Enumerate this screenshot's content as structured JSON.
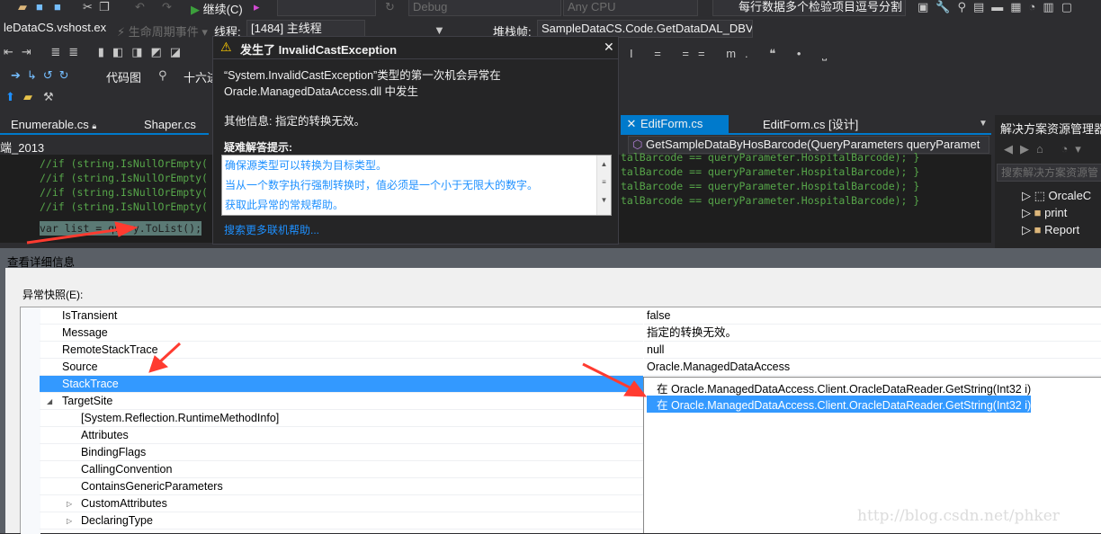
{
  "toolbar": {
    "continue_label": "继续(C)",
    "config": "Debug",
    "platform": "Any CPU",
    "search_combo": "每行数据多个检验项目逗号分割"
  },
  "debug_bar": {
    "process": "leDataCS.vshost.ex",
    "lifecycle": "生命周期事件",
    "thread_label": "线程:",
    "thread": "[1484] 主线程",
    "stackframe_label": "堆栈帧:",
    "stackframe": "SampleDataCS.Code.GetDataDAL_DBV"
  },
  "toolbar2": {
    "codemap": "代码图",
    "hex": "十六进"
  },
  "tabs": {
    "left": [
      "Enumerable.cs",
      "Shaper.cs"
    ],
    "right_active": "EditForm.cs",
    "right_other": "EditForm.cs [设计]"
  },
  "nav": {
    "left": "端_2013",
    "method": "GetSampleDataByHosBarcode(QueryParameters queryParamet"
  },
  "code": {
    "lines": [
      "//if (string.IsNullOrEmpty(",
      "//if (string.IsNullOrEmpty(",
      "//if (string.IsNullOrEmpty(",
      "//if (string.IsNullOrEmpty("
    ],
    "right_lines": [
      "talBarcode == queryParameter.HospitalBarcode); }",
      "talBarcode == queryParameter.HospitalBarcode); }",
      "talBarcode == queryParameter.HospitalBarcode); }",
      "talBarcode == queryParameter.HospitalBarcode); }"
    ],
    "current": "var list = query.ToList();"
  },
  "solution_explorer": {
    "title": "解决方案资源管理器",
    "search_placeholder": "搜索解决方案资源管",
    "items": [
      "OrcaleC",
      "print",
      "Report"
    ]
  },
  "exception": {
    "title": "发生了 InvalidCastException",
    "message_line1": "“System.InvalidCastException”类型的第一次机会异常在",
    "message_line2": "Oracle.ManagedDataAccess.dll 中发生",
    "other_info": "其他信息: 指定的转换无效。",
    "tips_label": "疑难解答提示:",
    "tips": [
      "确保源类型可以转换为目标类型。",
      "当从一个数字执行强制转换时，值必须是一个小于无限大的数字。",
      "获取此异常的常规帮助。"
    ],
    "search_link": "搜索更多联机帮助..."
  },
  "dialog": {
    "title": "查看详细信息",
    "snapshot_label": "异常快照(E):",
    "rows": [
      {
        "name": "IsTransient",
        "value": "false"
      },
      {
        "name": "Message",
        "value": "指定的转换无效。"
      },
      {
        "name": "RemoteStackTrace",
        "value": "null"
      },
      {
        "name": "Source",
        "value": "Oracle.ManagedDataAccess"
      },
      {
        "name": "StackTrace",
        "value": ""
      },
      {
        "name": "TargetSite",
        "value": ""
      },
      {
        "name": "[System.Reflection.RuntimeMethodInfo]",
        "value": ""
      },
      {
        "name": "Attributes",
        "value": ""
      },
      {
        "name": "BindingFlags",
        "value": ""
      },
      {
        "name": "CallingConvention",
        "value": ""
      },
      {
        "name": "ContainsGenericParameters",
        "value": ""
      },
      {
        "name": "CustomAttributes",
        "value": ""
      },
      {
        "name": "DeclaringType",
        "value": ""
      }
    ],
    "stacktrace_lines": [
      "在 Oracle.ManagedDataAccess.Client.OracleDataReader.GetString(Int32 i)",
      "在 Oracle.ManagedDataAccess.Client.OracleDataReader.GetString(Int32 i)"
    ]
  },
  "watermark": "http://blog.csdn.net/phker",
  "colors": {
    "vs_bg": "#2d2d30",
    "accent": "#007acc",
    "selection": "#3399ff",
    "annotation": "#ff3b30"
  }
}
